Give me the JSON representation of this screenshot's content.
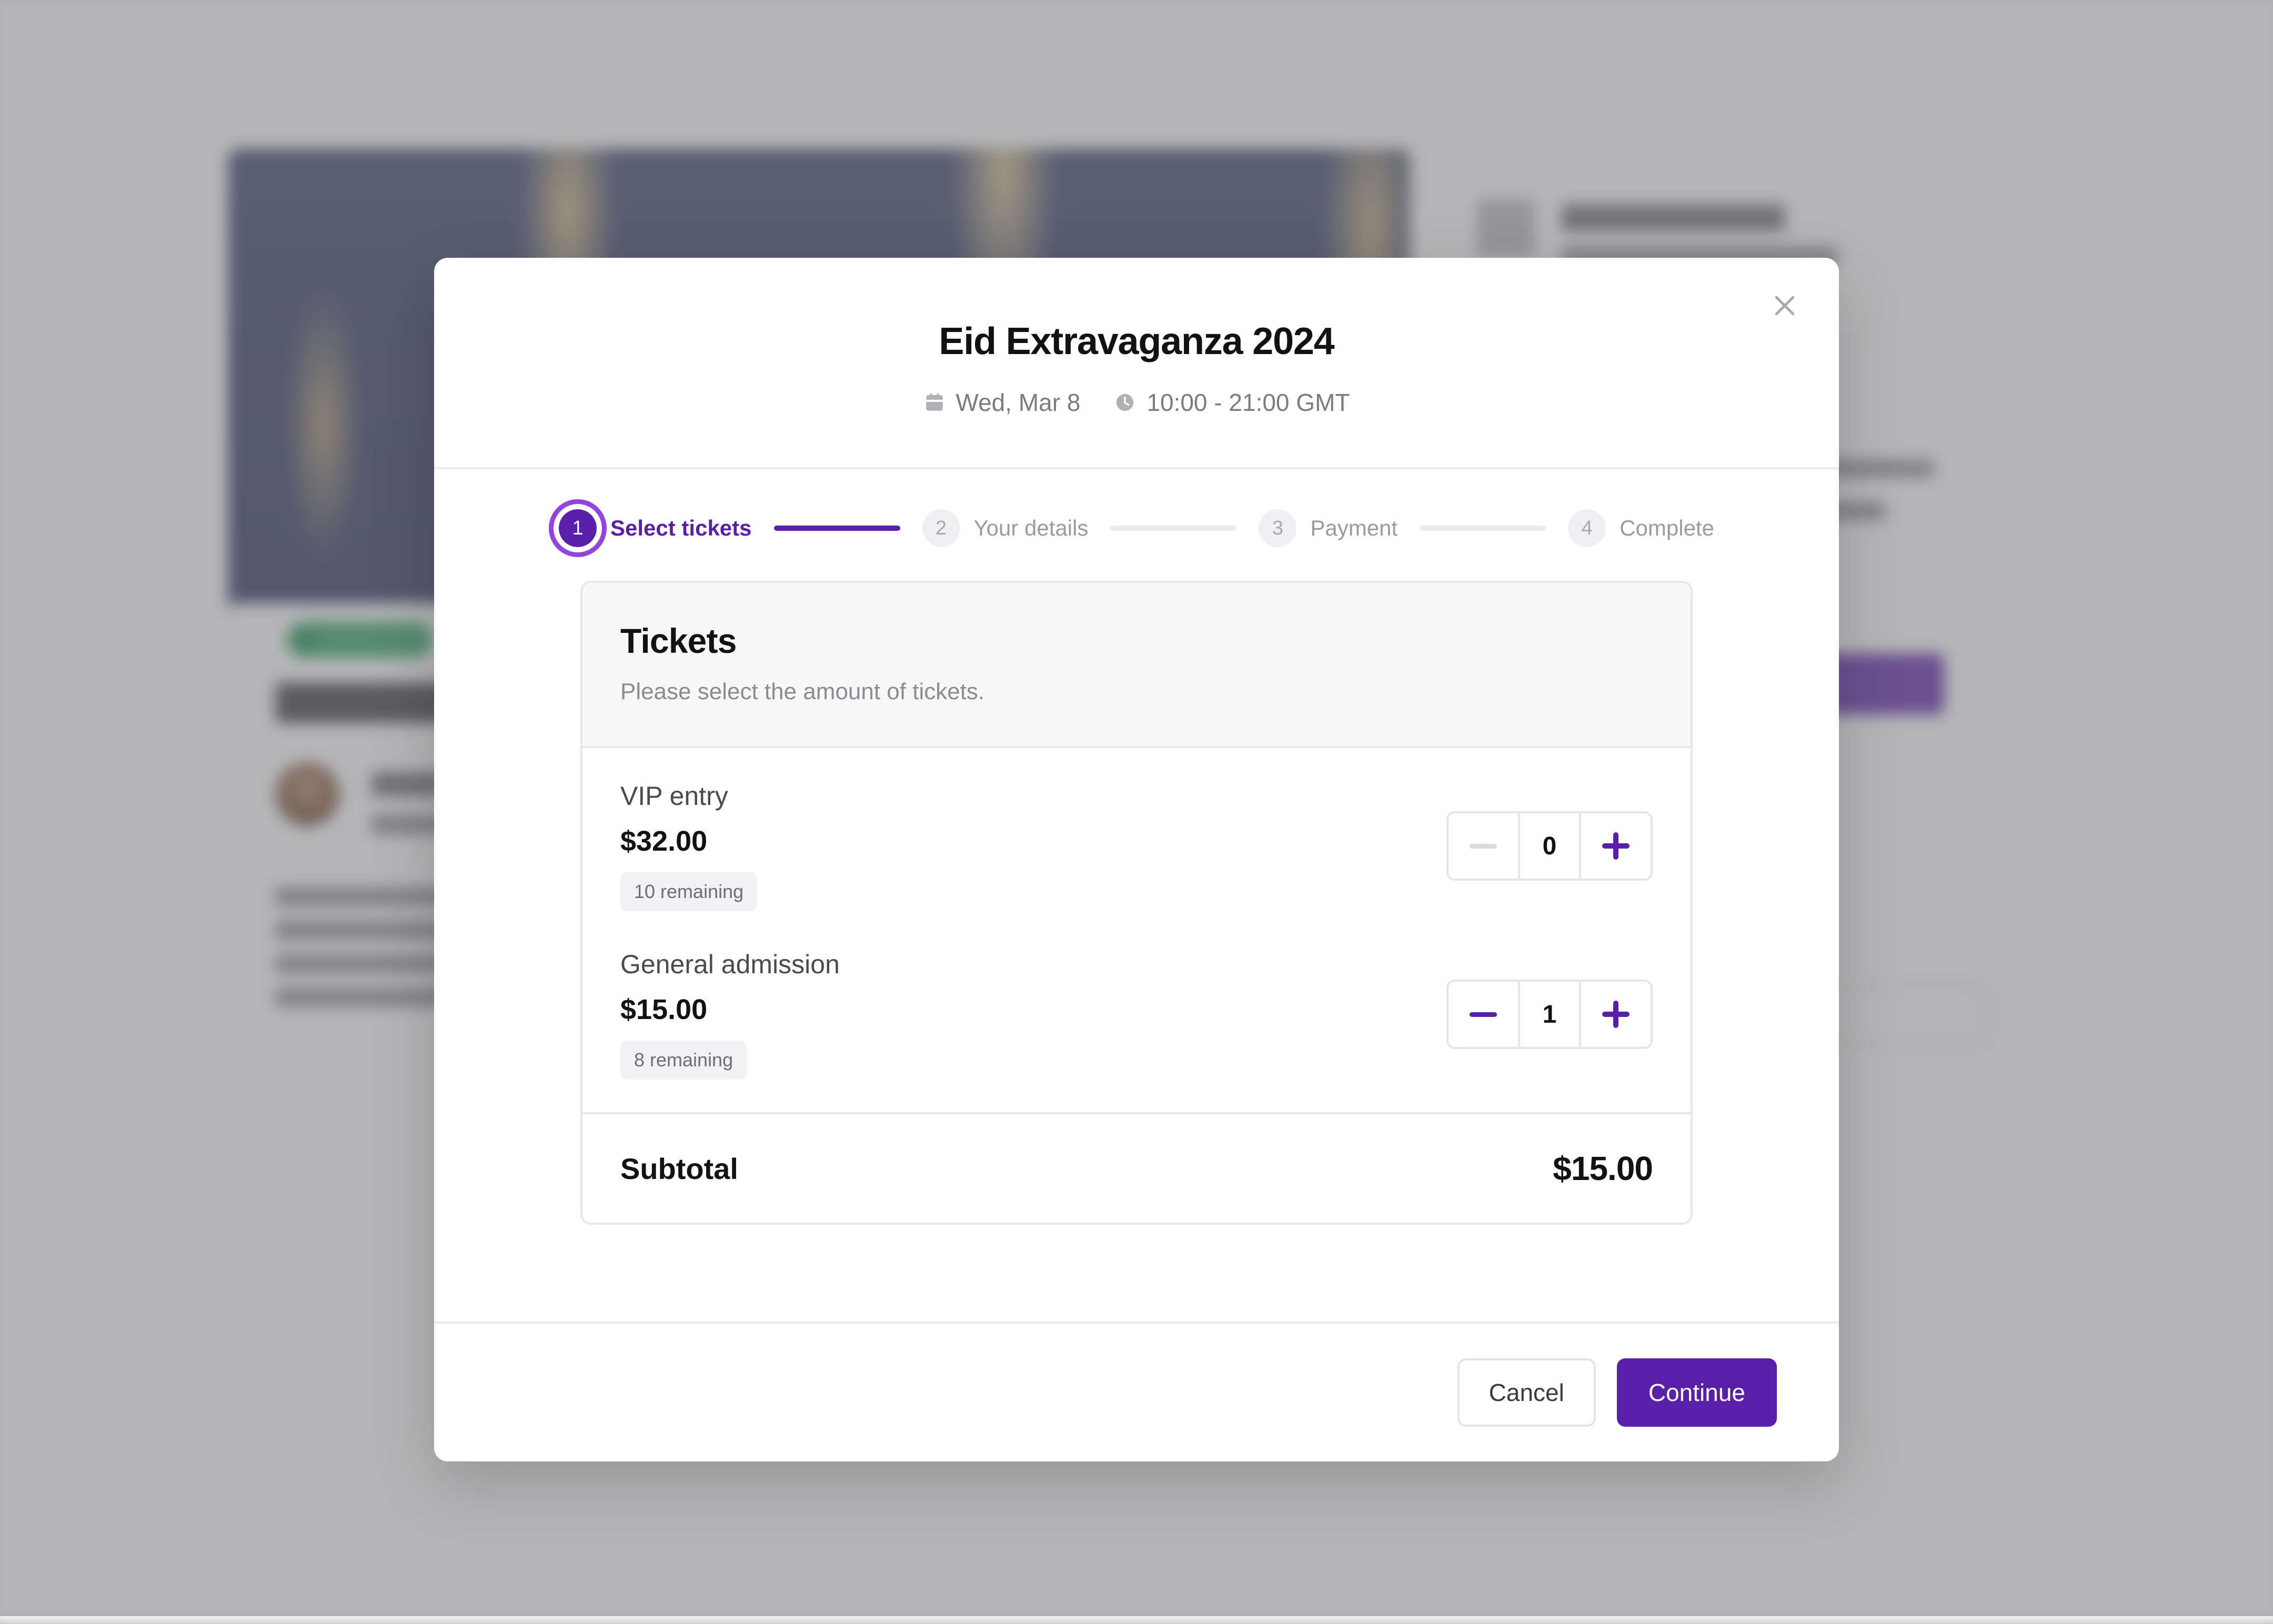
{
  "overlay": {
    "scrim_color": "#78787c"
  },
  "background": {
    "hero_colors": [
      "#2b3760",
      "#d6ba82"
    ],
    "badge_color": "#2fa35f",
    "accent_button_color": "#5a1fa8"
  },
  "modal": {
    "title": "Eid Extravaganza 2024",
    "close_icon": "close-icon",
    "meta": {
      "date_icon": "calendar-icon",
      "date": "Wed, Mar 8",
      "time_icon": "clock-icon",
      "time": "10:00 - 21:00 GMT"
    },
    "stepper": {
      "active_color": "#5a1fa8",
      "inactive_color": "#9a9aa0",
      "steps": [
        {
          "number": "1",
          "label": "Select tickets",
          "state": "active"
        },
        {
          "number": "2",
          "label": "Your details",
          "state": "inactive"
        },
        {
          "number": "3",
          "label": "Payment",
          "state": "inactive"
        },
        {
          "number": "4",
          "label": "Complete",
          "state": "inactive"
        }
      ]
    },
    "tickets": {
      "heading": "Tickets",
      "subheading": "Please select the amount of tickets.",
      "items": [
        {
          "name": "VIP entry",
          "price": "$32.00",
          "remaining": "10 remaining",
          "quantity": "0",
          "minus_enabled": false,
          "plus_enabled": true
        },
        {
          "name": "General admission",
          "price": "$15.00",
          "remaining": "8 remaining",
          "quantity": "1",
          "minus_enabled": true,
          "plus_enabled": true
        }
      ],
      "subtotal_label": "Subtotal",
      "subtotal_value": "$15.00"
    },
    "footer": {
      "cancel_label": "Cancel",
      "continue_label": "Continue"
    }
  }
}
